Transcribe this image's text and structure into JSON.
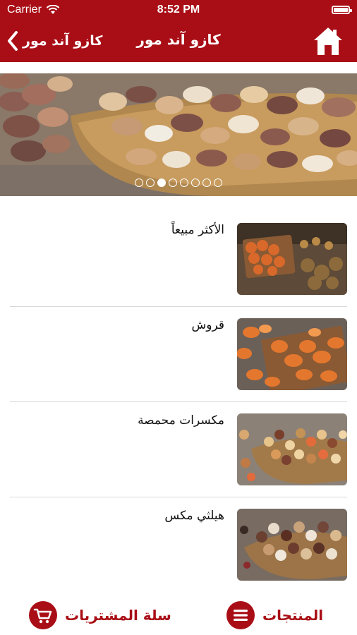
{
  "status_bar": {
    "carrier": "Carrier",
    "time": "8:52 PM"
  },
  "nav": {
    "back_label": "كازو آند مور",
    "title": "كازو آند مور"
  },
  "banner": {
    "dot_count": 8,
    "active_dot": 2
  },
  "categories": [
    {
      "label": "الأكثر مبيعاً",
      "icon": "snacks-tray-image"
    },
    {
      "label": "قروش",
      "icon": "chips-image"
    },
    {
      "label": "مكسرات محمصة",
      "icon": "roasted-nuts-basket-image"
    },
    {
      "label": "هيلثي مكس",
      "icon": "healthy-mix-basket-image"
    }
  ],
  "tabs": {
    "cart_label": "سلة المشتريات",
    "products_label": "المنتجات"
  },
  "colors": {
    "brand": "#a90e16",
    "separator": "#d8d8d8"
  }
}
